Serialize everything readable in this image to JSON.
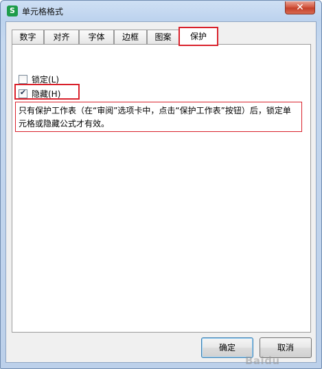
{
  "window": {
    "title": "单元格格式",
    "app_icon": "S",
    "close_glyph": "✕"
  },
  "tabs": [
    {
      "label": "数字",
      "active": false
    },
    {
      "label": "对齐",
      "active": false
    },
    {
      "label": "字体",
      "active": false
    },
    {
      "label": "边框",
      "active": false
    },
    {
      "label": "图案",
      "active": false
    },
    {
      "label": "保护",
      "active": true
    }
  ],
  "protection": {
    "lock_label": "锁定(L)",
    "lock_checked": false,
    "hide_label": "隐藏(H)",
    "hide_checked": true,
    "description": "只有保护工作表（在“审阅”选项卡中，点击“保护工作表”按钮）后，锁定单元格或隐藏公式才有效。"
  },
  "buttons": {
    "ok": "确定",
    "cancel": "取消"
  },
  "watermark": "Baidu",
  "colors": {
    "highlight": "#d9202a",
    "app_icon": "#1e9c4a"
  }
}
